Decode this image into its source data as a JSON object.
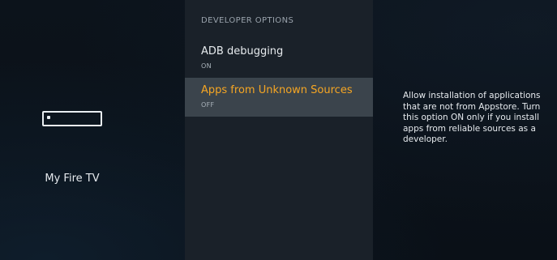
{
  "device": {
    "icon": "fire-tv-device-icon",
    "label": "My Fire TV"
  },
  "menu": {
    "section_title": "DEVELOPER OPTIONS",
    "items": [
      {
        "title": "ADB debugging",
        "status": "ON",
        "selected": false
      },
      {
        "title": "Apps from Unknown Sources",
        "status": "OFF",
        "selected": true
      }
    ]
  },
  "description": {
    "text": "Allow installation of applications that are not from Appstore. Turn this option ON only if you install apps from reliable sources as a developer."
  },
  "colors": {
    "accent_selected_text": "#f6a623",
    "selected_row_bg": "#3b444c",
    "menu_panel_bg": "#1a2129",
    "background": "#0b1016"
  }
}
